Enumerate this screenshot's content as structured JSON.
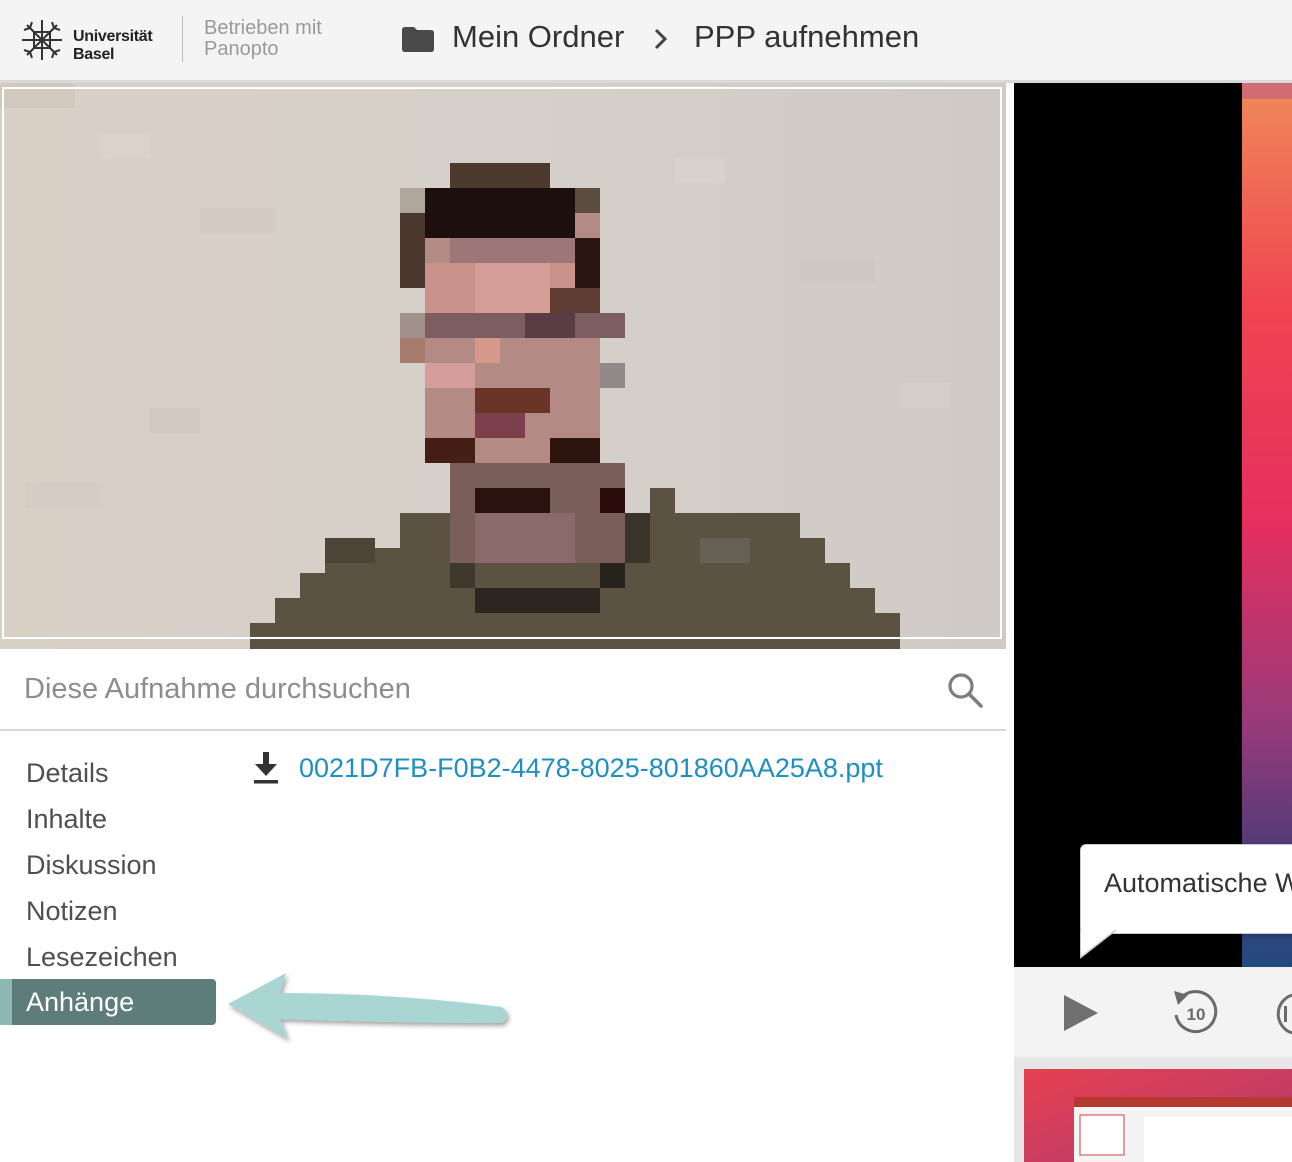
{
  "header": {
    "logo_text_line1": "Universität",
    "logo_text_line2": "Basel",
    "powered_line1": "Betrieben mit",
    "powered_line2": "Panopto",
    "breadcrumb": [
      {
        "label": "Mein Ordner"
      },
      {
        "label": "PPP aufnehmen"
      }
    ]
  },
  "search": {
    "placeholder": "Diese Aufnahme durchsuchen",
    "value": ""
  },
  "sidebar": {
    "items": [
      {
        "label": "Details"
      },
      {
        "label": "Inhalte"
      },
      {
        "label": "Diskussion"
      },
      {
        "label": "Notizen"
      },
      {
        "label": "Lesezeichen"
      },
      {
        "label": "Anhänge",
        "active": true
      }
    ]
  },
  "attachments": [
    {
      "filename": "0021D7FB-F0B2-4478-8025-801860AA25A8.ppt"
    }
  ],
  "player": {
    "tooltip": "Automatische W",
    "skip_back_seconds": "10"
  },
  "colors": {
    "accent_active": "#5e7d7a",
    "link": "#1f8fc2",
    "arrow": "#a9d6d2"
  },
  "icons": [
    "folder-icon",
    "chevron-right-icon",
    "search-icon",
    "download-icon",
    "play-icon",
    "rewind-10-icon",
    "forward-icon"
  ]
}
